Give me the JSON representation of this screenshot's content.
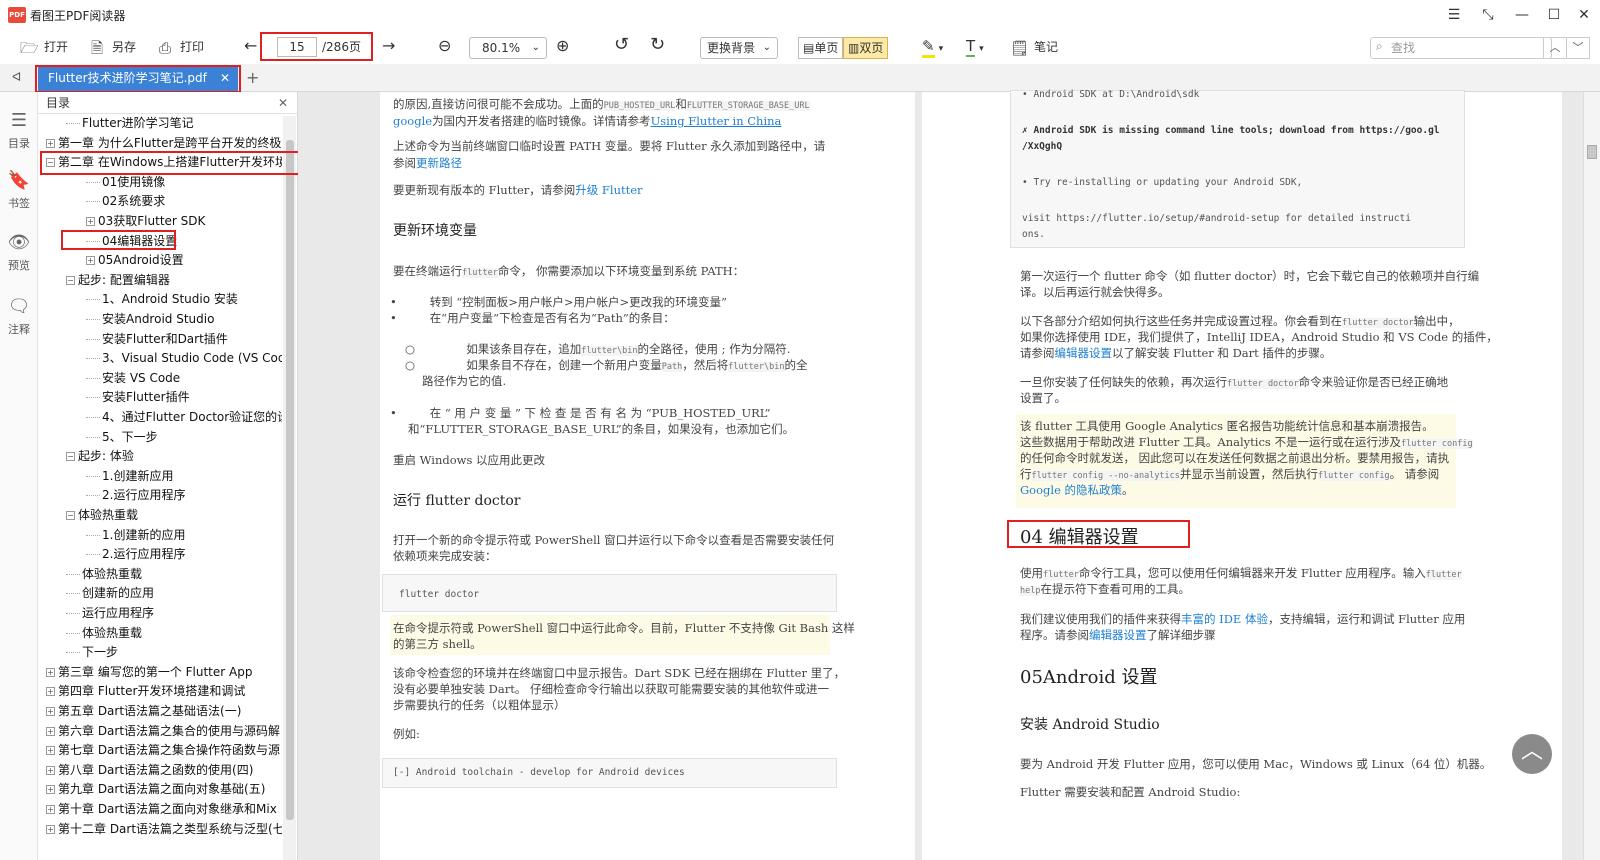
{
  "app": {
    "logo": "PDF",
    "title": "看图王PDF阅读器"
  },
  "window_controls": [
    "☰",
    "⤡",
    "—",
    "☐",
    "✕"
  ],
  "toolbar": {
    "open": "打开",
    "save_as": "另存",
    "print": "打印",
    "page_current": "15",
    "page_total": "/286页",
    "zoom": "80.1%",
    "background": "更换背景",
    "single_page": "单页",
    "double_page": "双页",
    "note": "笔记",
    "search_placeholder": "查找"
  },
  "tab": {
    "filename": "Flutter技术进阶学习笔记.pdf"
  },
  "leftbar": {
    "toc": "目录",
    "bookmarks": "书签",
    "preview": "预览",
    "annotations": "注释"
  },
  "toc": {
    "header": "目录",
    "items": [
      {
        "label": "Flutter进阶学习笔记",
        "expander": ""
      },
      {
        "label": "第一章 为什么Flutter是跨平台开发的终极",
        "expander": "+"
      },
      {
        "label": "第二章 在Windows上搭建Flutter开发环境",
        "expander": "−"
      },
      {
        "label": "01使用镜像",
        "expander": ""
      },
      {
        "label": "02系统要求",
        "expander": ""
      },
      {
        "label": "03获取Flutter SDK",
        "expander": "+"
      },
      {
        "label": "04编辑器设置",
        "expander": ""
      },
      {
        "label": "05Android设置",
        "expander": "+"
      },
      {
        "label": "起步: 配置编辑器",
        "expander": "−"
      },
      {
        "label": "1、Android Studio 安装",
        "expander": ""
      },
      {
        "label": "安装Android Studio",
        "expander": ""
      },
      {
        "label": "安装Flutter和Dart插件",
        "expander": ""
      },
      {
        "label": "3、Visual Studio Code (VS Cod",
        "expander": ""
      },
      {
        "label": "安装 VS Code",
        "expander": ""
      },
      {
        "label": "安装Flutter插件",
        "expander": ""
      },
      {
        "label": "4、通过Flutter Doctor验证您的设",
        "expander": ""
      },
      {
        "label": "5、下一步",
        "expander": ""
      },
      {
        "label": "起步: 体验",
        "expander": "−"
      },
      {
        "label": "1.创建新应用",
        "expander": ""
      },
      {
        "label": "2.运行应用程序",
        "expander": ""
      },
      {
        "label": "体验热重载",
        "expander": "−"
      },
      {
        "label": "1.创建新的应用",
        "expander": ""
      },
      {
        "label": "2.运行应用程序",
        "expander": ""
      },
      {
        "label": "体验热重载",
        "expander": ""
      },
      {
        "label": "创建新的应用",
        "expander": ""
      },
      {
        "label": "运行应用程序",
        "expander": ""
      },
      {
        "label": "体验热重载",
        "expander": ""
      },
      {
        "label": "下一步",
        "expander": ""
      },
      {
        "label": "第三章 编写您的第一个 Flutter App",
        "expander": "+"
      },
      {
        "label": "第四章 Flutter开发环境搭建和调试",
        "expander": "+"
      },
      {
        "label": "第五章 Dart语法篇之基础语法(一)",
        "expander": "+"
      },
      {
        "label": "第六章 Dart语法篇之集合的使用与源码解",
        "expander": "+"
      },
      {
        "label": "第七章 Dart语法篇之集合操作符函数与源",
        "expander": "+"
      },
      {
        "label": "第八章 Dart语法篇之函数的使用(四)",
        "expander": "+"
      },
      {
        "label": "第九章 Dart语法篇之面向对象基础(五)",
        "expander": "+"
      },
      {
        "label": "第十章 Dart语法篇之面向对象继承和Mix",
        "expander": "+"
      },
      {
        "label": "第十二章 Dart语法篇之类型系统与泛型(七",
        "expander": "+"
      }
    ]
  },
  "left_page": {
    "p1a": "的原因,直接访问很可能不会成功。上面的",
    "p1_code1": "PUB_HOSTED_URL",
    "p1_and": "和",
    "p1_code2": "FLUTTER_STORAGE_BASE_URL",
    "p1b_google": "google",
    "p1b": "为国内开发者搭建的临时镜像。详情请参考",
    "p1b_link": "Using Flutter in China",
    "p2": "上述命令为当前终端窗口临时设置 PATH 变量。要将 Flutter 永久添加到路径中，请参阅",
    "p2_link": "更新路径",
    "p3": "要更新现有版本的 Flutter，请参阅",
    "p3_link": "升级 Flutter",
    "h_env": "更新环境变量",
    "p4a": "要在终端运行",
    "p4_code": "flutter",
    "p4b": "命令，  你需要添加以下环境变量到系统 PATH：",
    "b1": "转到 “控制面板>用户帐户>用户帐户>更改我的环境变量”",
    "b2": "在“用户变量”下检查是否有名为“Path”的条目：",
    "sb1a": "如果该条目存在，追加",
    "sb1_code": "flutter\\bin",
    "sb1b": "的全路径，使用 ; 作为分隔符.",
    "sb2a": "如果条目不存在，创建一个新用户变量",
    "sb2_code1": "Path",
    "sb2b": "，然后将",
    "sb2_code2": "flutter\\bin",
    "sb2c": "的全",
    "sb2d": "路径作为它的值.",
    "b3a": "在 “ 用 户 变 量 ” 下 检 查 是 否 有 名 为 “PUB_HOSTED_URL”",
    "b3b": "和“FLUTTER_STORAGE_BASE_URL”的条目，如果没有，也添加它们。",
    "p5": "重启 Windows 以应用此更改",
    "h_doctor": "运行  flutter doctor",
    "p6a": "打开一个新的命令提示符或 PowerShell 窗口并运行以下命令以查看是否需要安装任何",
    "p6b": "依赖项来完成安装：",
    "code1": "flutter doctor",
    "note1a": "在命令提示符或 PowerShell 窗口中运行此命令。目前，Flutter 不支持像 Git Bash 这样",
    "note1b": "的第三方 shell。",
    "p7a": "该命令检查您的环境并在终端窗口中显示报告。Dart SDK 已经在捆绑在 Flutter 里了，",
    "p7b": "没有必要单独安装 Dart。 仔细检查命令行输出以获取可能需要安装的其他软件或进一",
    "p7c": "步需要执行的任务（以粗体显示）",
    "p8": "例如:",
    "code2": "[-] Android toolchain - develop for Android devices"
  },
  "right_page": {
    "code_l1": "• Android SDK at D:\\Android\\sdk",
    "code_l2": "✗ Android SDK is missing command line tools; download from https://goo.gl",
    "code_l3": "/XxQghQ",
    "code_l4": "• Try re-installing or updating your Android SDK,",
    "code_l5": "visit https://flutter.io/setup/#android-setup for detailed instructi",
    "code_l6": "ons.",
    "r1a": "第一次运行一个 flutter 命令（如 flutter doctor）时，它会下载它自己的依赖项并自行编",
    "r1b": "译。以后再运行就会快得多。",
    "r2a": "以下各部分介绍如何执行这些任务并完成设置过程。你会看到在",
    "r2_code": "flutter doctor",
    "r2b": "输出中，",
    "r2c": "如果你选择使用 IDE，我们提供了，IntelliJ IDEA，Android Studio 和 VS Code 的插件，",
    "r2d": "请参阅",
    "r2_link": "编辑器设置",
    "r2e": "以了解安装 Flutter 和 Dart 插件的步骤。",
    "r3a": "一旦你安装了任何缺失的依赖，再次运行",
    "r3_code": "flutter doctor",
    "r3b": "命令来验证你是否已经正确地",
    "r3c": "设置了。",
    "n1": "该 flutter 工具使用 Google Analytics 匿名报告功能统计信息和基本崩溃报告。",
    "n2a": "这些数据用于帮助改进 Flutter 工具。Analytics 不是一运行或在运行涉及",
    "n2_code": "flutter config",
    "n3": "的任何命令时就发送，  因此您可以在发送任何数据之前退出分析。要禁用报告，请执",
    "n4a": "行",
    "n4_code": "flutter config --no-analytics",
    "n4b": "并显示当前设置，然后执行",
    "n4_code2": "flutter config",
    "n4c": "。 请参阅",
    "n5_link": "Google 的隐私政策",
    "h_editor": "04 编辑器设置",
    "e1a": "使用",
    "e1_code": "flutter",
    "e1b": "命令行工具，您可以使用任何编辑器来开发 Flutter 应用程序。输入",
    "e1_code2": "flutter",
    "e1c_code": "help",
    "e1d": "在提示符下查看可用的工具。",
    "e2a": "我们建议使用我们的插件来获得",
    "e2_link": "丰富的 IDE 体验",
    "e2b": "，支持编辑，运行和调试 Flutter 应用",
    "e2c": "程序。请参阅",
    "e2_link2": "编辑器设置",
    "e2d": "了解详细步骤",
    "h_android": "05Android 设置",
    "h_studio": "安装 Android Studio",
    "a1": "要为 Android 开发 Flutter 应用，您可以使用 Mac，Windows 或 Linux（64 位）机器。",
    "a2": "Flutter 需要安装和配置 Android Studio:"
  },
  "colors": {
    "accent": "#3b82d6",
    "highlight": "#e02020",
    "link": "#1e7fd2",
    "active_view": "#fde9a6"
  }
}
